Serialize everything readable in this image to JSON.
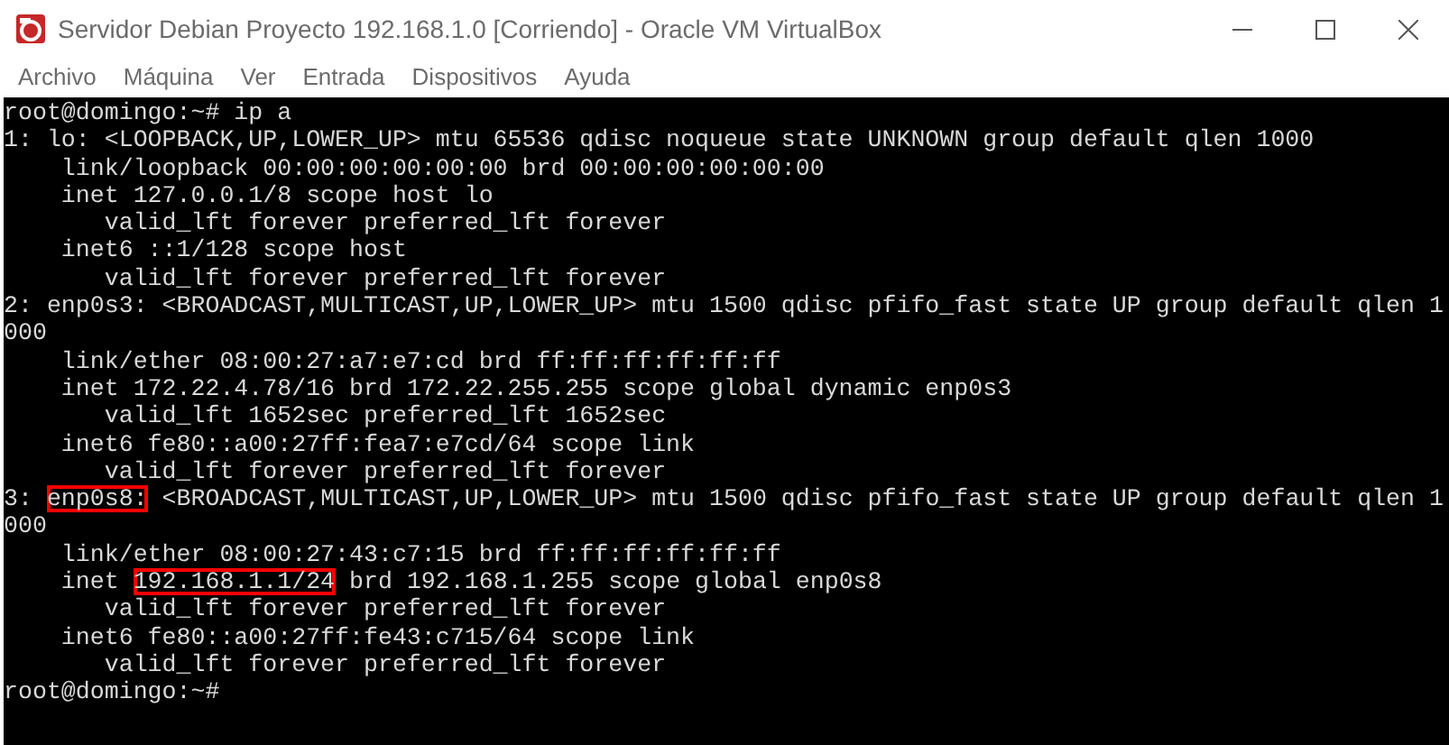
{
  "window": {
    "title": "Servidor Debian Proyecto 192.168.1.0 [Corriendo] - Oracle VM VirtualBox"
  },
  "menu": [
    "Archivo",
    "Máquina",
    "Ver",
    "Entrada",
    "Dispositivos",
    "Ayuda"
  ],
  "terminal": {
    "lines": [
      {
        "segments": [
          {
            "text": "root@domingo:~# ip a",
            "highlighted": false
          }
        ]
      },
      {
        "segments": [
          {
            "text": "1: lo: <LOOPBACK,UP,LOWER_UP> mtu 65536 qdisc noqueue state UNKNOWN group default qlen 1000",
            "highlighted": false
          }
        ]
      },
      {
        "segments": [
          {
            "text": "    link/loopback 00:00:00:00:00:00 brd 00:00:00:00:00:00",
            "highlighted": false
          }
        ]
      },
      {
        "segments": [
          {
            "text": "    inet 127.0.0.1/8 scope host lo",
            "highlighted": false
          }
        ]
      },
      {
        "segments": [
          {
            "text": "       valid_lft forever preferred_lft forever",
            "highlighted": false
          }
        ]
      },
      {
        "segments": [
          {
            "text": "    inet6 ::1/128 scope host",
            "highlighted": false
          }
        ]
      },
      {
        "segments": [
          {
            "text": "       valid_lft forever preferred_lft forever",
            "highlighted": false
          }
        ]
      },
      {
        "segments": [
          {
            "text": "2: enp0s3: <BROADCAST,MULTICAST,UP,LOWER_UP> mtu 1500 qdisc pfifo_fast state UP group default qlen 1",
            "highlighted": false
          }
        ]
      },
      {
        "segments": [
          {
            "text": "000",
            "highlighted": false
          }
        ]
      },
      {
        "segments": [
          {
            "text": "    link/ether 08:00:27:a7:e7:cd brd ff:ff:ff:ff:ff:ff",
            "highlighted": false
          }
        ]
      },
      {
        "segments": [
          {
            "text": "    inet 172.22.4.78/16 brd 172.22.255.255 scope global dynamic enp0s3",
            "highlighted": false
          }
        ]
      },
      {
        "segments": [
          {
            "text": "       valid_lft 1652sec preferred_lft 1652sec",
            "highlighted": false
          }
        ]
      },
      {
        "segments": [
          {
            "text": "    inet6 fe80::a00:27ff:fea7:e7cd/64 scope link",
            "highlighted": false
          }
        ]
      },
      {
        "segments": [
          {
            "text": "       valid_lft forever preferred_lft forever",
            "highlighted": false
          }
        ]
      },
      {
        "segments": [
          {
            "text": "3: ",
            "highlighted": false
          },
          {
            "text": "enp0s8:",
            "highlighted": true
          },
          {
            "text": " <BROADCAST,MULTICAST,UP,LOWER_UP> mtu 1500 qdisc pfifo_fast state UP group default qlen 1",
            "highlighted": false
          }
        ]
      },
      {
        "segments": [
          {
            "text": "000",
            "highlighted": false
          }
        ]
      },
      {
        "segments": [
          {
            "text": "    link/ether 08:00:27:43:c7:15 brd ff:ff:ff:ff:ff:ff",
            "highlighted": false
          }
        ]
      },
      {
        "segments": [
          {
            "text": "    inet ",
            "highlighted": false
          },
          {
            "text": "192.168.1.1/24",
            "highlighted": true
          },
          {
            "text": " brd 192.168.1.255 scope global enp0s8",
            "highlighted": false
          }
        ]
      },
      {
        "segments": [
          {
            "text": "       valid_lft forever preferred_lft forever",
            "highlighted": false
          }
        ]
      },
      {
        "segments": [
          {
            "text": "    inet6 fe80::a00:27ff:fe43:c715/64 scope link",
            "highlighted": false
          }
        ]
      },
      {
        "segments": [
          {
            "text": "       valid_lft forever preferred_lft forever",
            "highlighted": false
          }
        ]
      },
      {
        "segments": [
          {
            "text": "root@domingo:~#",
            "highlighted": false
          }
        ]
      }
    ]
  }
}
